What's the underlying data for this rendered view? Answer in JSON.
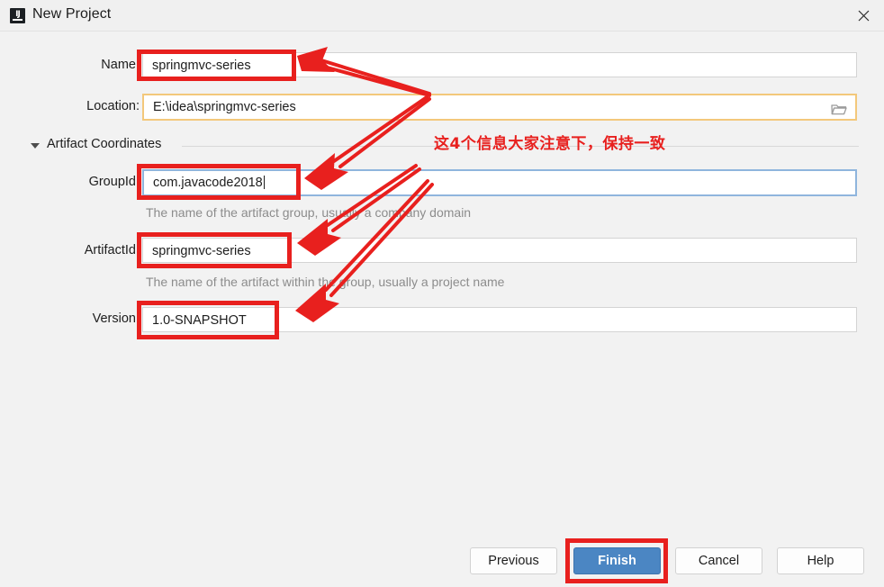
{
  "window": {
    "title": "New Project",
    "app_icon": "intellij-idea-icon",
    "close_icon": "close-icon"
  },
  "form": {
    "name": {
      "label": "Name:",
      "value": "springmvc-series",
      "placeholder": ""
    },
    "location": {
      "label": "Location:",
      "value": "E:\\idea\\springmvc-series",
      "placeholder": "",
      "browse_icon": "folder-icon"
    },
    "section": {
      "label": "Artifact Coordinates",
      "expand_icon": "chevron-down-icon"
    },
    "group_id": {
      "label": "GroupId:",
      "value": "com.javacode2018",
      "placeholder": "",
      "hint": "The name of the artifact group, usually a company domain"
    },
    "artifact_id": {
      "label": "ArtifactId:",
      "value": "springmvc-series",
      "placeholder": "",
      "hint": "The name of the artifact within the group, usually a project name"
    },
    "version": {
      "label": "Version:",
      "value": "1.0-SNAPSHOT",
      "placeholder": ""
    }
  },
  "buttons": {
    "previous": "Previous",
    "finish": "Finish",
    "cancel": "Cancel",
    "help": "Help"
  },
  "annotation": {
    "note": "这4个信息大家注意下，保持一致",
    "color": "#e8201e"
  },
  "colors": {
    "accent": "#4b86c3",
    "annotation_red": "#e8201e",
    "focus_border": "#8fb5dd",
    "warn_border": "#f3c87b",
    "dialog_background": "#f2f2f2",
    "hint_text": "#8c8c8c"
  }
}
